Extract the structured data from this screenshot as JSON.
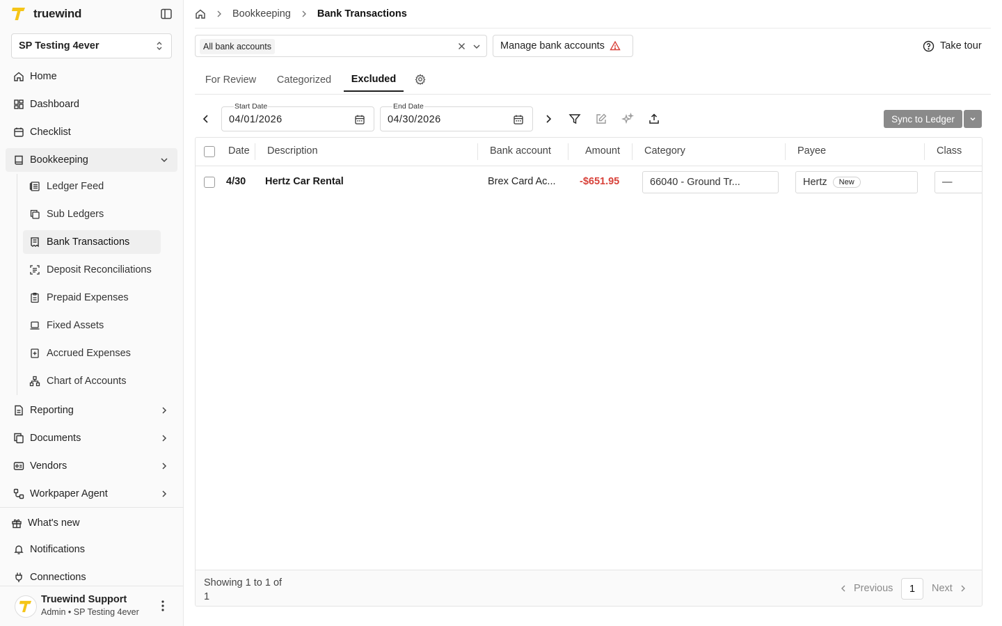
{
  "brand": {
    "name": "truewind",
    "logo_color": "#f5c518"
  },
  "org": {
    "selected": "SP Testing 4ever"
  },
  "nav": {
    "home": "Home",
    "dashboard": "Dashboard",
    "checklist": "Checklist",
    "bookkeeping": "Bookkeeping",
    "bookkeeping_children": [
      {
        "label": "Ledger Feed",
        "icon": "ledger-icon"
      },
      {
        "label": "Sub Ledgers",
        "icon": "copy-icon"
      },
      {
        "label": "Bank Transactions",
        "icon": "receipt-icon",
        "active": true
      },
      {
        "label": "Deposit Reconciliations",
        "icon": "scan-text-icon"
      },
      {
        "label": "Prepaid Expenses",
        "icon": "clipboard-icon"
      },
      {
        "label": "Fixed Assets",
        "icon": "laptop-icon"
      },
      {
        "label": "Accrued Expenses",
        "icon": "file-plus-icon"
      },
      {
        "label": "Chart of Accounts",
        "icon": "network-icon"
      }
    ],
    "reporting": "Reporting",
    "documents": "Documents",
    "vendors": "Vendors",
    "workpaper_agent": "Workpaper Agent",
    "whats_new": "What's new",
    "notifications": "Notifications",
    "connections": "Connections"
  },
  "user": {
    "name": "Truewind Support",
    "role": "Admin • SP Testing 4ever"
  },
  "breadcrumb": {
    "parent": "Bookkeeping",
    "current": "Bank Transactions"
  },
  "filters": {
    "account_chip": "All bank accounts",
    "manage_label": "Manage bank accounts",
    "tour_label": "Take tour"
  },
  "tabs": {
    "for_review": "For Review",
    "categorized": "Categorized",
    "excluded": "Excluded",
    "active": "Excluded"
  },
  "dates": {
    "start_label": "Start Date",
    "start_value": "04/01/2026",
    "end_label": "End Date",
    "end_value": "04/30/2026"
  },
  "sync": {
    "label": "Sync to Ledger"
  },
  "table": {
    "columns": {
      "date": "Date",
      "description": "Description",
      "bank_account": "Bank account",
      "amount": "Amount",
      "category": "Category",
      "payee": "Payee",
      "class": "Class"
    },
    "rows": [
      {
        "date": "4/30",
        "description": "Hertz Car Rental",
        "bank_account": "Brex Card Ac...",
        "amount": "-$651.95",
        "category": "66040 - Ground Tr...",
        "payee": "Hertz",
        "payee_badge": "New",
        "class": "—"
      }
    ],
    "footer": {
      "showing": "Showing 1 to 1 of 1",
      "previous": "Previous",
      "page": "1",
      "next": "Next"
    }
  },
  "colors": {
    "negative_amount": "#d8423a",
    "sync_button": "#8a8a8a",
    "warning": "#d8423a"
  }
}
